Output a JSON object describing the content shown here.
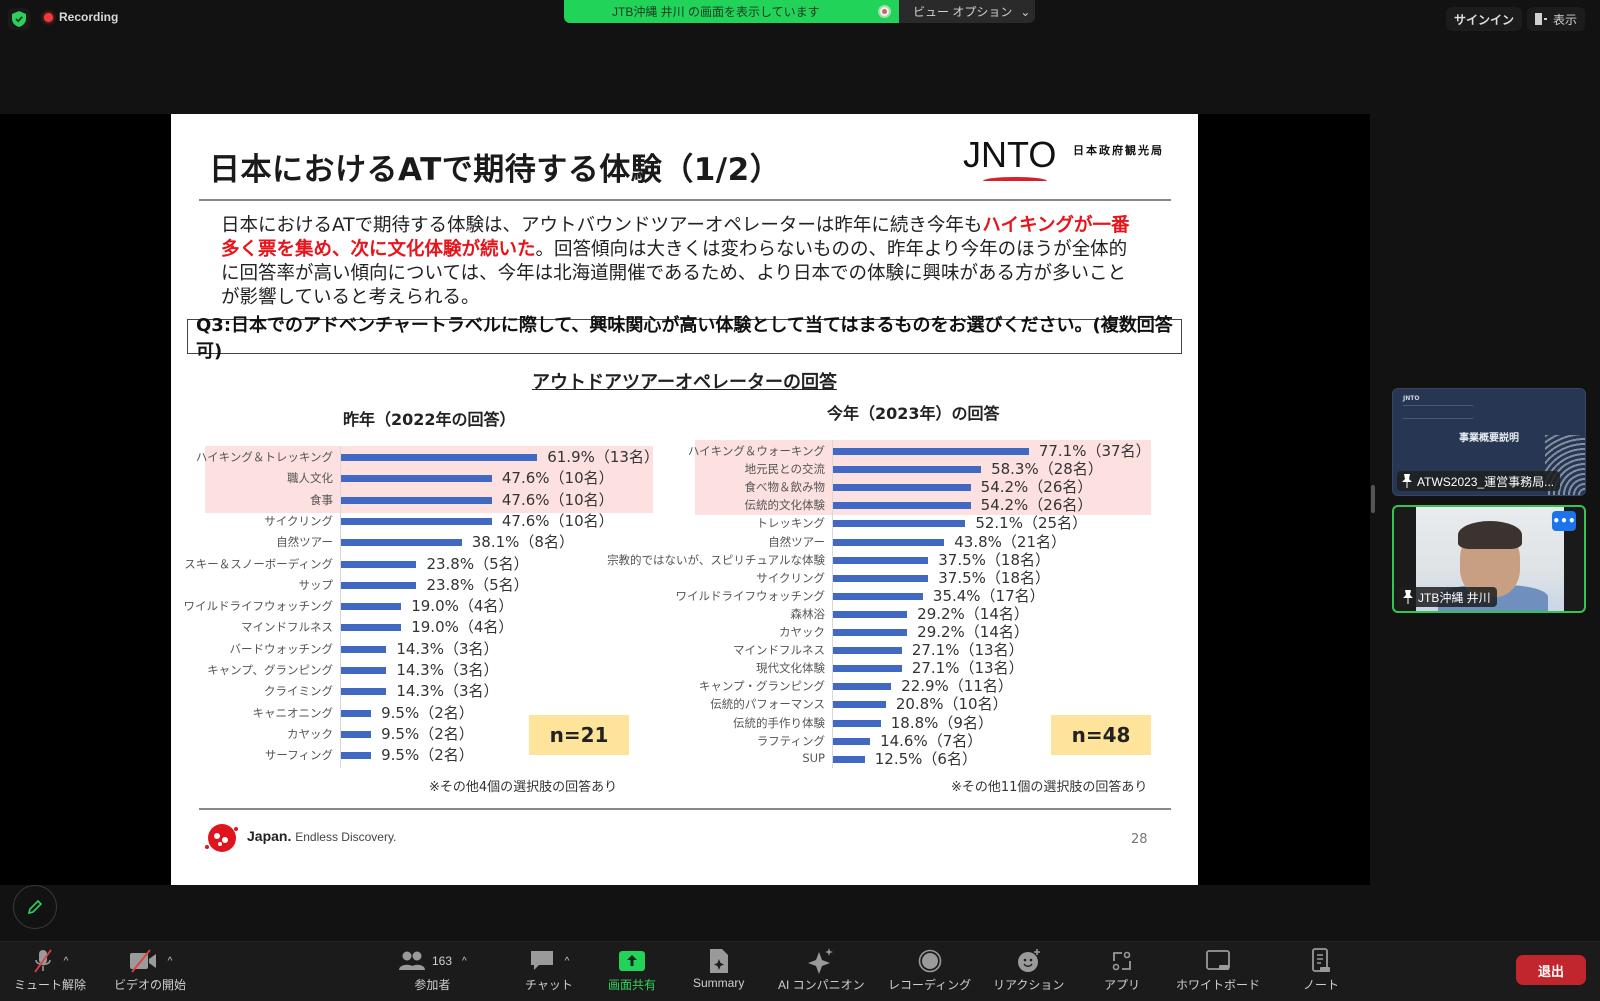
{
  "topbar": {
    "recording_label": "Recording",
    "share_banner": "JTB沖縄 井川 の画面を表示しています",
    "view_options": "ビュー オプション",
    "signin": "サインイン",
    "display": "表示"
  },
  "slide": {
    "title": "日本におけるATで期待する体験（1/2）",
    "logo_text": "JNTO",
    "logo_sub": "日本政府観光局",
    "intro_part1": "日本におけるATで期待する体験は、アウトバウンドツアーオペレーターは昨年に続き今年も",
    "intro_highlight": "ハイキングが一番多く票を集め、次に文化体験が続いた",
    "intro_part2": "。回答傾向は大きくは変わらないものの、昨年より今年のほうが全体的に回答率が高い傾向については、今年は北海道開催であるため、より日本での体験に興味がある方が多いことが影響していると考えられる。",
    "question": "Q3:日本でのアドベンチャートラベルに際して、興味関心が高い体験として当てはまるものをお選びください。(複数回答可)",
    "chart_heading": "アウトドアツアーオペレーターの回答",
    "footer_brand": "Japan.",
    "footer_tagline": "Endless Discovery.",
    "page_number": "28"
  },
  "chart_data": [
    {
      "type": "bar",
      "orientation": "horizontal",
      "title": "昨年（2022年の回答）",
      "n_label": "n=21",
      "note": "※その他4個の選択肢の回答あり",
      "highlighted_count": 3,
      "categories": [
        "ハイキング＆トレッキング",
        "職人文化",
        "食事",
        "サイクリング",
        "自然ツアー",
        "スキー＆スノーボーディング",
        "サップ",
        "ワイルドライフウォッチング",
        "マインドフルネス",
        "バードウォッチング",
        "キャンプ、グランピング",
        "クライミング",
        "キャニオニング",
        "カヤック",
        "サーフィング"
      ],
      "values": [
        61.9,
        47.6,
        47.6,
        47.6,
        38.1,
        23.8,
        23.8,
        19.0,
        19.0,
        14.3,
        14.3,
        14.3,
        9.5,
        9.5,
        9.5
      ],
      "labels": [
        "61.9%（13名）",
        "47.6%（10名）",
        "47.6%（10名）",
        "47.6%（10名）",
        "38.1%（8名）",
        "23.8%（5名）",
        "23.8%（5名）",
        "19.0%（4名）",
        "19.0%（4名）",
        "14.3%（3名）",
        "14.3%（3名）",
        "14.3%（3名）",
        "9.5%（2名）",
        "9.5%（2名）",
        "9.5%（2名）"
      ],
      "xlim": [
        0,
        100
      ]
    },
    {
      "type": "bar",
      "orientation": "horizontal",
      "title": "今年（2023年）の回答",
      "n_label": "n=48",
      "note": "※その他11個の選択肢の回答あり",
      "highlighted_count": 4,
      "categories": [
        "ハイキング＆ウォーキング",
        "地元民との交流",
        "食べ物＆飲み物",
        "伝統的文化体験",
        "トレッキング",
        "自然ツアー",
        "宗教的ではないが、スピリチュアルな体験",
        "サイクリング",
        "ワイルドライフウォッチング",
        "森林浴",
        "カヤック",
        "マインドフルネス",
        "現代文化体験",
        "キャンプ・グランピング",
        "伝統的パフォーマンス",
        "伝統的手作り体験",
        "ラフティング",
        "SUP"
      ],
      "values": [
        77.1,
        58.3,
        54.2,
        54.2,
        52.1,
        43.8,
        37.5,
        37.5,
        35.4,
        29.2,
        29.2,
        27.1,
        27.1,
        22.9,
        20.8,
        18.8,
        14.6,
        12.5
      ],
      "labels": [
        "77.1%（37名）",
        "58.3%（28名）",
        "54.2%（26名）",
        "54.2%（26名）",
        "52.1%（25名）",
        "43.8%（21名）",
        "37.5%（18名）",
        "37.5%（18名）",
        "35.4%（17名）",
        "29.2%（14名）",
        "29.2%（14名）",
        "27.1%（13名）",
        "27.1%（13名）",
        "22.9%（11名）",
        "20.8%（10名）",
        "18.8%（9名）",
        "14.6%（7名）",
        "12.5%（6名）"
      ],
      "xlim": [
        0,
        100
      ]
    }
  ],
  "participants": [
    {
      "name": "ATWS2023_運営事務局...",
      "thumb_title": "事業概要説明"
    },
    {
      "name": "JTB沖縄 井川",
      "active_speaker": true
    }
  ],
  "toolbar": {
    "items": [
      {
        "id": "mute",
        "label": "ミュート解除",
        "icon": "mic-off-icon"
      },
      {
        "id": "video",
        "label": "ビデオの開始",
        "icon": "video-off-icon"
      },
      {
        "id": "participants",
        "label": "参加者",
        "icon": "participants-icon",
        "count": "163"
      },
      {
        "id": "chat",
        "label": "チャット",
        "icon": "chat-icon"
      },
      {
        "id": "share",
        "label": "画面共有",
        "icon": "share-screen-icon"
      },
      {
        "id": "summary",
        "label": "Summary",
        "icon": "summary-icon"
      },
      {
        "id": "ai",
        "label": "AI コンパニオン",
        "icon": "ai-companion-icon"
      },
      {
        "id": "record",
        "label": "レコーディング",
        "icon": "record-icon"
      },
      {
        "id": "reactions",
        "label": "リアクション",
        "icon": "reaction-icon"
      },
      {
        "id": "apps",
        "label": "アプリ",
        "icon": "apps-icon"
      },
      {
        "id": "whiteboard",
        "label": "ホワイトボード",
        "icon": "whiteboard-icon"
      },
      {
        "id": "notes",
        "label": "ノート",
        "icon": "notes-icon"
      }
    ],
    "leave_label": "退出"
  },
  "colors": {
    "bar": "#4169c4",
    "highlight_bg": "#fde0e0",
    "n_box": "#fde49a",
    "accent_red": "#e8141c",
    "zoom_green": "#22d35a",
    "leave_red": "#c0262b"
  }
}
